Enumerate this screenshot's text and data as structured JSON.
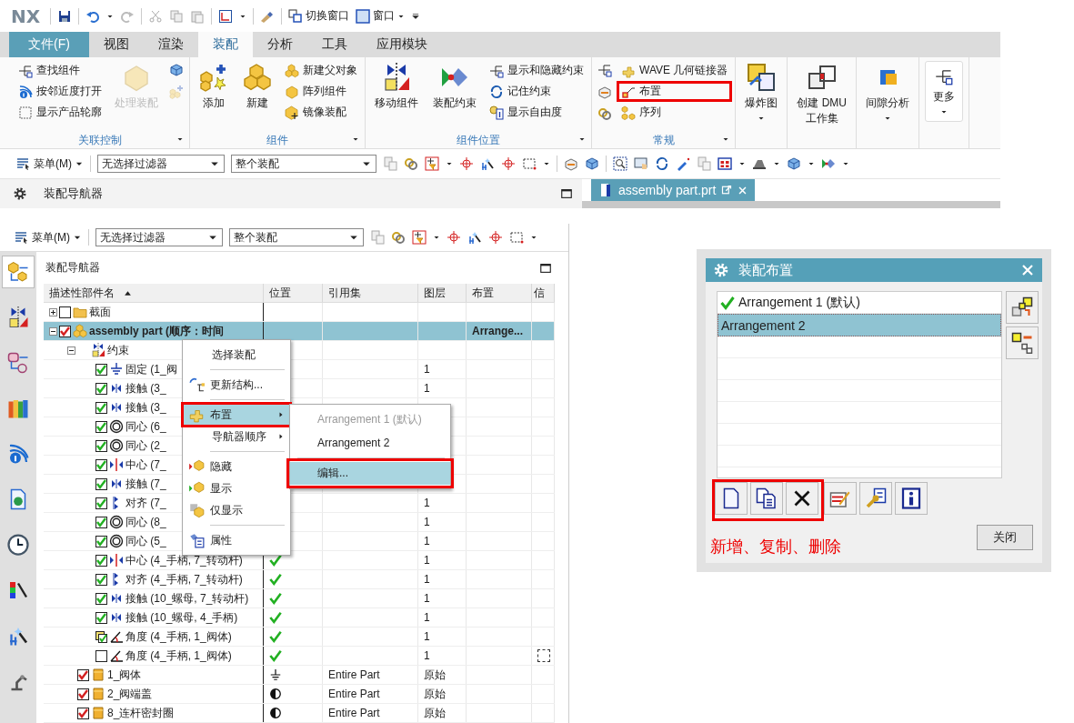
{
  "quick_access": {
    "logo": "NX",
    "switch_window": "切换窗口",
    "window_menu": "窗口"
  },
  "ribbon_tabs": [
    {
      "label": "文件(F)",
      "kind": "file",
      "selected": false
    },
    {
      "label": "视图",
      "kind": "tab",
      "selected": false
    },
    {
      "label": "渲染",
      "kind": "tab",
      "selected": false
    },
    {
      "label": "装配",
      "kind": "tab",
      "selected": true
    },
    {
      "label": "分析",
      "kind": "tab",
      "selected": false
    },
    {
      "label": "工具",
      "kind": "tab",
      "selected": false
    },
    {
      "label": "应用模块",
      "kind": "tab",
      "selected": false
    }
  ],
  "ribbon_groups": [
    {
      "title": "关联控制",
      "columns": [
        {
          "kind": "stack",
          "items": [
            {
              "label": "查找组件",
              "highlighted": false
            },
            {
              "label": "按邻近度打开",
              "highlighted": false
            },
            {
              "label": "显示产品轮廓",
              "highlighted": false
            }
          ]
        },
        {
          "kind": "large",
          "label": "处理装配",
          "disabled": true,
          "dropdown": false
        },
        {
          "kind": "icons",
          "items": [
            {
              "disabled": false
            },
            {
              "disabled": true
            }
          ]
        }
      ]
    },
    {
      "title": "组件",
      "columns": [
        {
          "kind": "large",
          "label": "添加",
          "disabled": false,
          "dropdown": false
        },
        {
          "kind": "large",
          "label": "新建",
          "disabled": false,
          "dropdown": false
        },
        {
          "kind": "stack",
          "items": [
            {
              "label": "新建父对象",
              "highlighted": false
            },
            {
              "label": "阵列组件",
              "highlighted": false
            },
            {
              "label": "镜像装配",
              "highlighted": false
            }
          ]
        }
      ]
    },
    {
      "title": "组件位置",
      "columns": [
        {
          "kind": "large",
          "label": "移动组件",
          "disabled": false,
          "dropdown": false
        },
        {
          "kind": "large",
          "label": "装配约束",
          "disabled": false,
          "dropdown": false
        },
        {
          "kind": "stack",
          "items": [
            {
              "label": "显示和隐藏约束",
              "highlighted": false
            },
            {
              "label": "记住约束",
              "highlighted": false
            },
            {
              "label": "显示自由度",
              "highlighted": false
            }
          ]
        }
      ]
    },
    {
      "title": "常规",
      "columns": [
        {
          "kind": "icons",
          "items": [
            {
              "disabled": false
            },
            {
              "disabled": false
            },
            {
              "disabled": false
            }
          ]
        },
        {
          "kind": "stack",
          "items": [
            {
              "label": "WAVE 几何链接器",
              "highlighted": false
            },
            {
              "label": "布置",
              "highlighted": true
            },
            {
              "label": "序列",
              "highlighted": false
            }
          ]
        }
      ]
    },
    {
      "columns": [
        {
          "kind": "large",
          "label": "爆炸图",
          "disabled": false,
          "dropdown": true
        }
      ]
    },
    {
      "columns": [
        {
          "kind": "large",
          "label": "创建 DMU\n工作集",
          "disabled": false,
          "dropdown": false
        }
      ]
    },
    {
      "columns": [
        {
          "kind": "large",
          "label": "间隙分析",
          "disabled": false,
          "dropdown": true
        }
      ]
    },
    {
      "columns": [
        {
          "kind": "more",
          "label": "更多",
          "disabled": false,
          "dropdown": true
        }
      ]
    }
  ],
  "toolbar": {
    "menu": "菜单(M)",
    "filter": "无选择过滤器",
    "scope": "整个装配"
  },
  "navigator_bar": {
    "title": "装配导航器"
  },
  "document_tab": {
    "label": "assembly part.prt"
  },
  "panel": {
    "toolbar": {
      "menu": "菜单(M)",
      "filter": "无选择过滤器",
      "scope": "整个装配"
    },
    "resource_bar": [
      {
        "selected": true
      },
      {
        "selected": false
      },
      {
        "selected": false
      },
      {
        "selected": false
      },
      {
        "selected": false
      },
      {
        "selected": false
      },
      {
        "selected": false
      },
      {
        "selected": false
      },
      {
        "selected": false
      },
      {
        "selected": false
      }
    ],
    "title": "装配导航器",
    "columns": [
      {
        "label": "描述性部件名",
        "sorted": true
      },
      {
        "label": "位置",
        "sorted": false
      },
      {
        "label": "引用集",
        "sorted": false
      },
      {
        "label": "图层",
        "sorted": false
      },
      {
        "label": "布置",
        "sorted": false
      },
      {
        "label": "信",
        "sorted": false
      }
    ],
    "tree": [
      {
        "label": "截面",
        "kind": "section",
        "checked": false,
        "partial": false,
        "expanded": false,
        "selected": false
      },
      {
        "label": "assembly part (顺序：时间",
        "kind": "assembly",
        "checked": true,
        "partial": false,
        "expanded": true,
        "selected": true,
        "arrangement": "Arrange...",
        "children": [
          {
            "label": "约束",
            "kind": "constraints",
            "expanded": true,
            "selected": false,
            "children": [
              {
                "label": "固定 (1_阀",
                "kind": "fixed",
                "checked": true,
                "partial": false,
                "selected": false,
                "layer": "1"
              },
              {
                "label": "接触 (3_",
                "kind": "touch",
                "checked": true,
                "partial": false,
                "selected": false,
                "layer": "1"
              },
              {
                "label": "接触 (3_",
                "kind": "touch",
                "checked": true,
                "partial": false,
                "selected": false
              },
              {
                "label": "同心 (6_",
                "kind": "concentric",
                "checked": true,
                "partial": false,
                "selected": false
              },
              {
                "label": "同心 (2_",
                "kind": "concentric",
                "checked": true,
                "partial": false,
                "selected": false
              },
              {
                "label": "中心 (7_",
                "kind": "center",
                "checked": true,
                "partial": false,
                "selected": false
              },
              {
                "label": "接触 (7_",
                "kind": "touch",
                "checked": true,
                "partial": false,
                "selected": false
              },
              {
                "label": "对齐 (7_",
                "kind": "align",
                "checked": true,
                "partial": false,
                "selected": false,
                "layer": "1"
              },
              {
                "label": "同心 (8_",
                "kind": "concentric",
                "checked": true,
                "partial": false,
                "selected": false,
                "layer": "1"
              },
              {
                "label": "同心 (5_",
                "kind": "concentric",
                "checked": true,
                "partial": false,
                "selected": false,
                "layer": "1"
              },
              {
                "label": "中心 (4_手柄, 7_转动杆)",
                "kind": "center",
                "checked": true,
                "partial": false,
                "selected": false,
                "position": {
                  "kind": "located"
                },
                "layer": "1"
              },
              {
                "label": "对齐 (4_手柄, 7_转动杆)",
                "kind": "align",
                "checked": true,
                "partial": false,
                "selected": false,
                "position": {
                  "kind": "located"
                },
                "layer": "1"
              },
              {
                "label": "接触 (10_螺母, 7_转动杆)",
                "kind": "touch",
                "checked": true,
                "partial": false,
                "selected": false,
                "position": {
                  "kind": "located"
                },
                "layer": "1"
              },
              {
                "label": "接触 (10_螺母, 4_手柄)",
                "kind": "touch",
                "checked": true,
                "partial": false,
                "selected": false,
                "position": {
                  "kind": "located"
                },
                "layer": "1"
              },
              {
                "label": "角度 (4_手柄, 1_阀体)",
                "kind": "angle",
                "checked": true,
                "partial": true,
                "selected": false,
                "position": {
                  "kind": "located"
                },
                "layer": "1"
              },
              {
                "label": "角度 (4_手柄, 1_阀体)",
                "kind": "angle",
                "checked": false,
                "partial": false,
                "selected": false,
                "position": {
                  "kind": "located"
                },
                "layer": "1",
                "info_box": true
              }
            ]
          },
          {
            "label": "1_阀体",
            "kind": "part",
            "checked": true,
            "partial": false,
            "selected": false,
            "position": {
              "kind": "fixed"
            },
            "reference_set": "Entire Part",
            "layer": "原始"
          },
          {
            "label": "2_阀端盖",
            "kind": "part",
            "checked": true,
            "partial": false,
            "selected": false,
            "position": {
              "kind": "partial"
            },
            "reference_set": "Entire Part",
            "layer": "原始"
          },
          {
            "label": "8_连杆密封圈",
            "kind": "part",
            "checked": true,
            "partial": false,
            "selected": false,
            "position": {
              "kind": "partial"
            },
            "reference_set": "Entire Part",
            "layer": "原始"
          }
        ]
      }
    ]
  },
  "context_menu": [
    {
      "kind": "command",
      "label": "选择装配",
      "highlighted": false
    },
    {
      "kind": "separator"
    },
    {
      "kind": "command",
      "label": "更新结构...",
      "highlighted": false
    },
    {
      "kind": "separator"
    },
    {
      "kind": "submenu",
      "label": "布置",
      "highlighted": true
    },
    {
      "kind": "submenu",
      "label": "导航器顺序",
      "highlighted": false
    },
    {
      "kind": "separator"
    },
    {
      "kind": "command",
      "label": "隐藏",
      "highlighted": false
    },
    {
      "kind": "command",
      "label": "显示",
      "highlighted": false
    },
    {
      "kind": "command",
      "label": "仅显示",
      "highlighted": false
    },
    {
      "kind": "separator"
    },
    {
      "kind": "command",
      "label": "属性",
      "highlighted": false
    }
  ],
  "submenu": [
    {
      "kind": "option",
      "label": "Arrangement 1 (默认)",
      "disabled": true,
      "highlighted": false
    },
    {
      "kind": "option",
      "label": "Arrangement 2",
      "disabled": false,
      "highlighted": false
    },
    {
      "kind": "separator"
    },
    {
      "kind": "command",
      "label": "编辑...",
      "disabled": false,
      "highlighted": true
    }
  ],
  "dialog": {
    "title": "装配布置",
    "arrangements": [
      {
        "label": "Arrangement 1 (默认)",
        "active": true,
        "selected": false
      },
      {
        "label": "Arrangement 2",
        "active": false,
        "selected": true
      }
    ],
    "tools": [
      {
        "kind": "new",
        "annotated": true
      },
      {
        "kind": "copy",
        "annotated": true
      },
      {
        "kind": "delete",
        "annotated": true
      },
      {
        "kind": "edit",
        "annotated": false
      },
      {
        "kind": "properties",
        "annotated": false
      },
      {
        "kind": "info",
        "annotated": false
      }
    ],
    "note": "新增、复制、删除",
    "close_button": "关闭"
  }
}
